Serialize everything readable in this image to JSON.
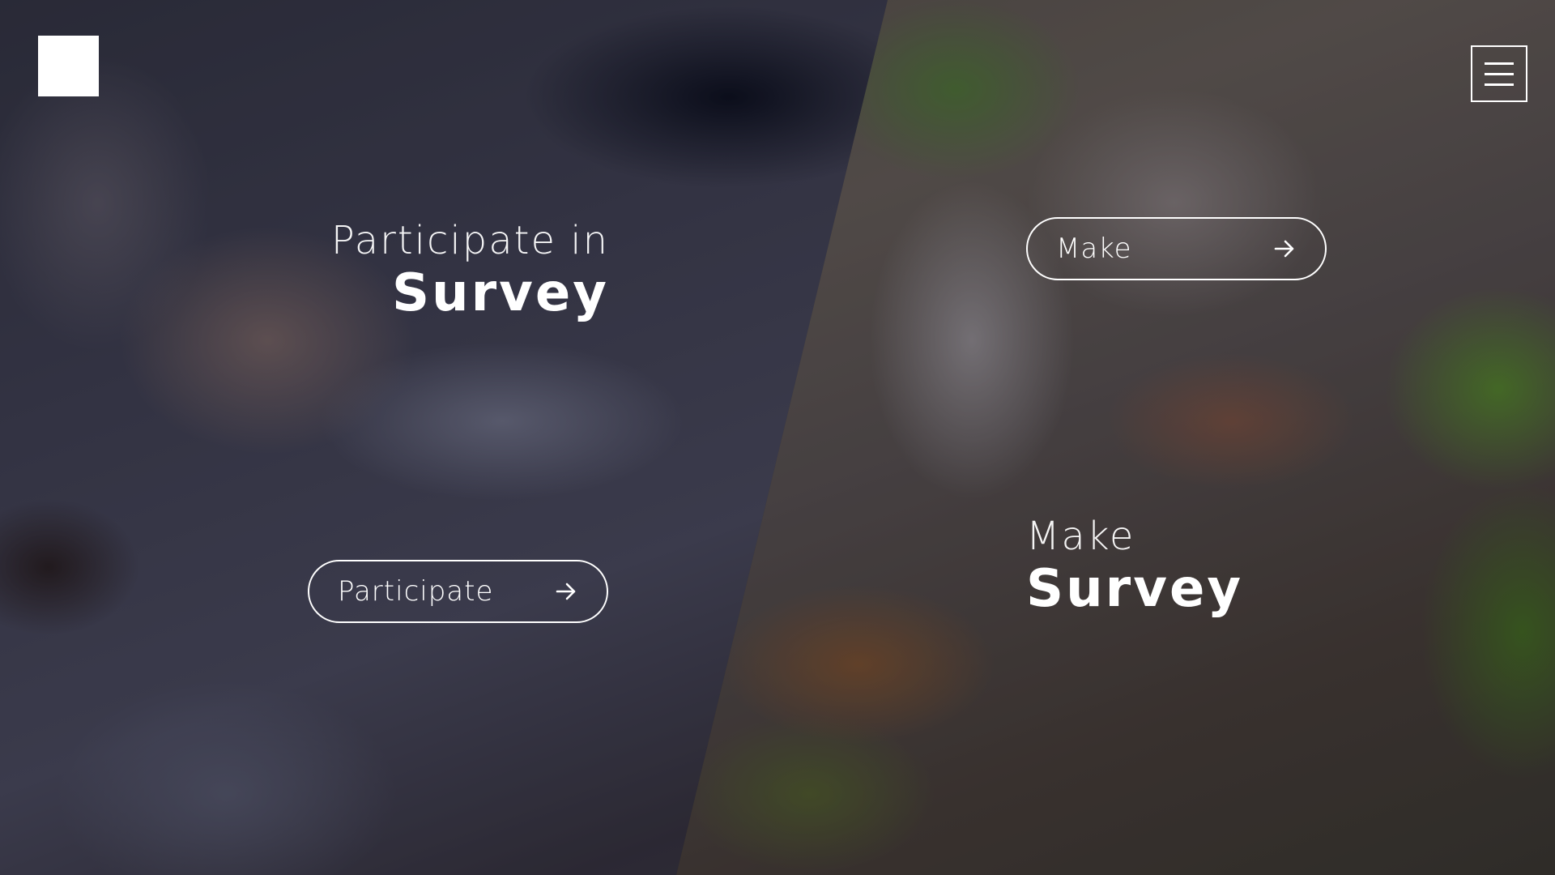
{
  "header": {
    "logo": "square-logo",
    "menu_icon": "hamburger-menu-icon"
  },
  "participate": {
    "heading_light": "Participate in",
    "heading_bold": "Survey",
    "button_label": "Participate",
    "button_icon": "arrow-right-icon"
  },
  "make": {
    "heading_light": "Make",
    "heading_bold": "Survey",
    "button_label": "Make",
    "button_icon": "arrow-right-icon"
  },
  "colors": {
    "text": "#ffffff",
    "logo": "#ffffff"
  }
}
